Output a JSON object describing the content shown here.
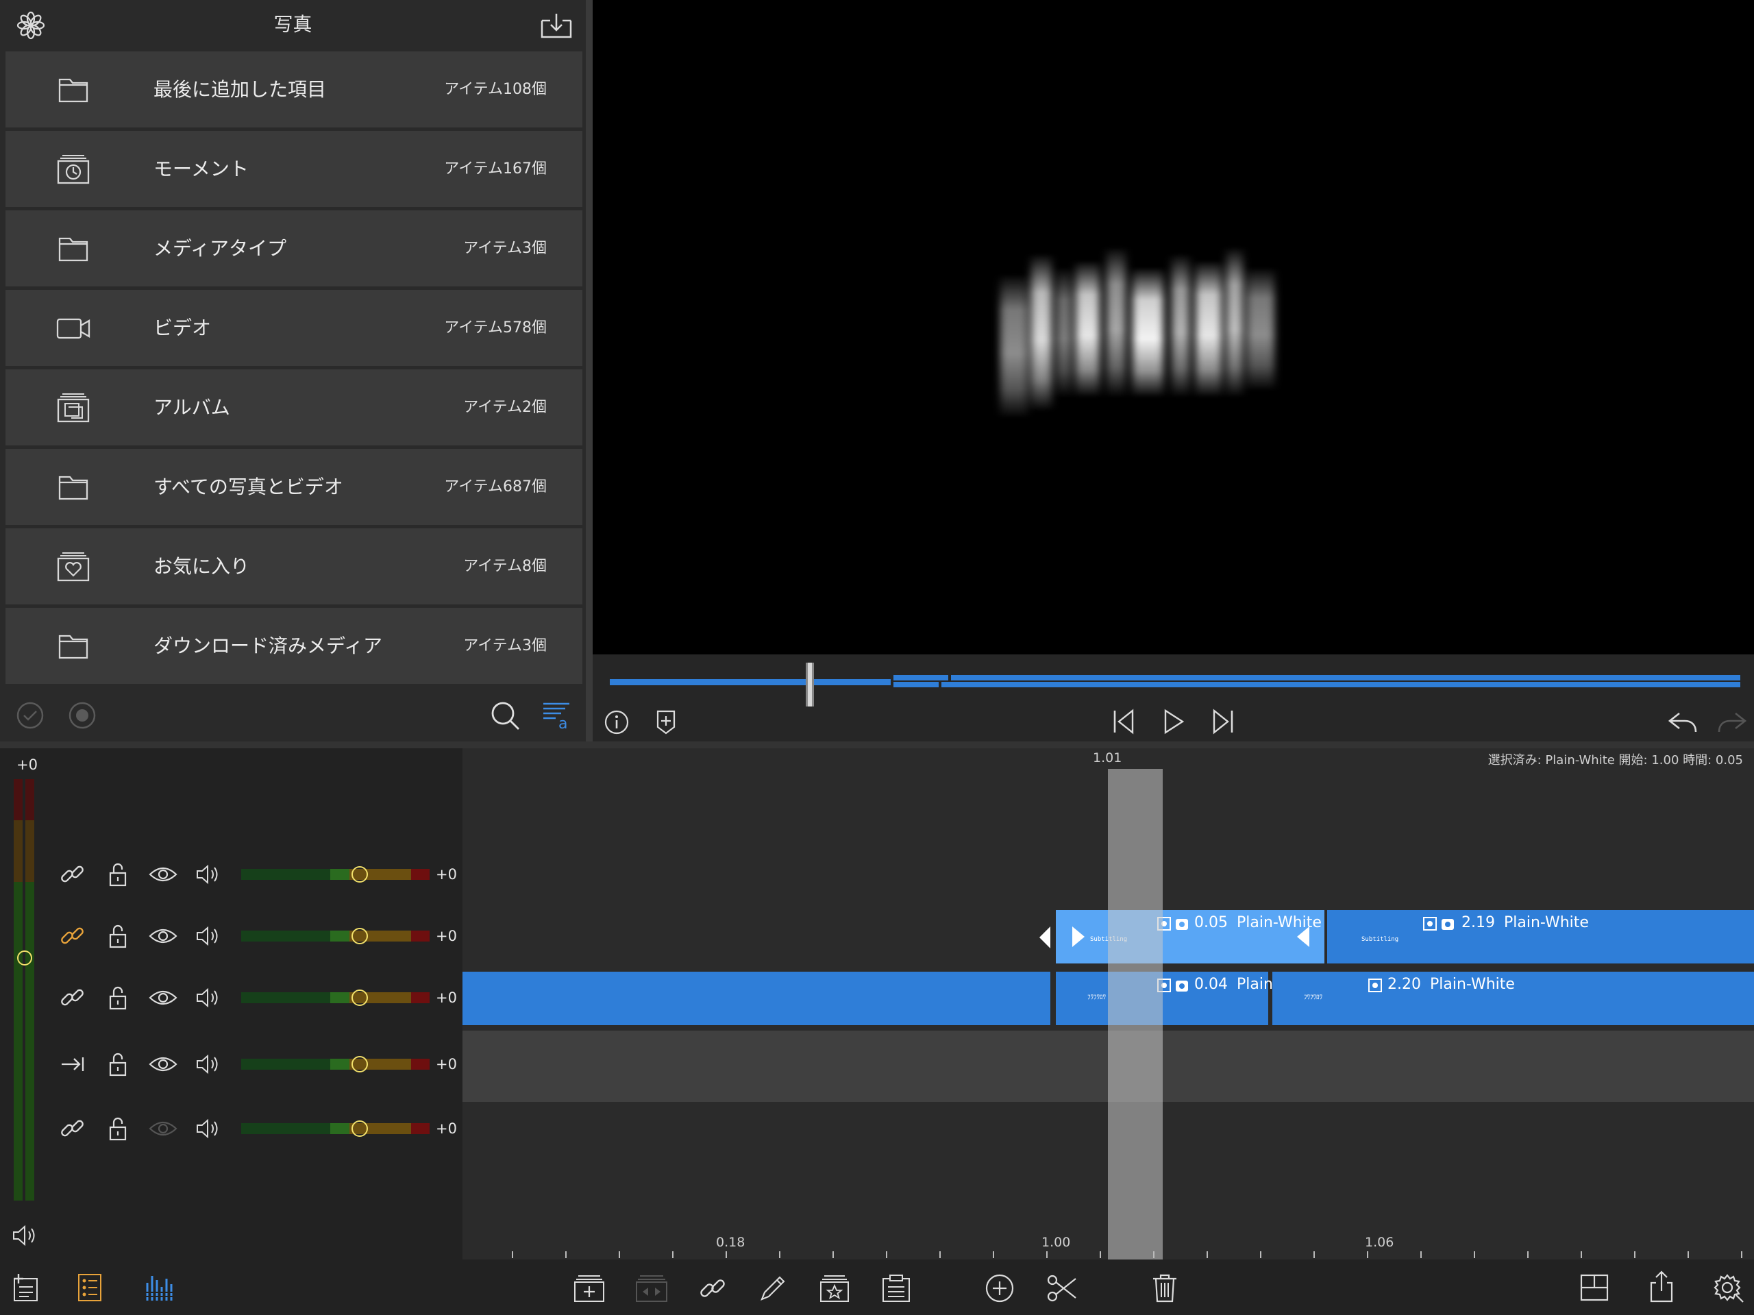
{
  "browser": {
    "title": "写真",
    "items": [
      {
        "label": "最後に追加した項目",
        "count": "アイテム108個",
        "icon": "folder-icon"
      },
      {
        "label": "モーメント",
        "count": "アイテム167個",
        "icon": "moments-clock-icon"
      },
      {
        "label": "メディアタイプ",
        "count": "アイテム3個",
        "icon": "folder-icon"
      },
      {
        "label": "ビデオ",
        "count": "アイテム578個",
        "icon": "video-camera-icon"
      },
      {
        "label": "アルバム",
        "count": "アイテム2個",
        "icon": "album-icon"
      },
      {
        "label": "すべての写真とビデオ",
        "count": "アイテム687個",
        "icon": "folder-icon"
      },
      {
        "label": "お気に入り",
        "count": "アイテム8個",
        "icon": "favorites-heart-icon"
      },
      {
        "label": "ダウンロード済みメディア",
        "count": "アイテム3個",
        "icon": "folder-icon"
      }
    ]
  },
  "timeline": {
    "master_volume": "+0",
    "track_volumes": [
      "+0",
      "+0",
      "+0",
      "+0",
      "+0"
    ],
    "selection_info": "選択済み: Plain-White 開始: 1.00 時間: 0.05",
    "playhead_time": "1.01",
    "ruler_labels": [
      "0.18",
      "1.00",
      "1.06"
    ],
    "clips": {
      "selected_title": {
        "duration": "0.05",
        "name": "Plain-White",
        "thumb": "Subtitling"
      },
      "title_2": {
        "duration": "2.19",
        "name": "Plain-White",
        "thumb": "Subtitling"
      },
      "video_1": {
        "duration": "0.04",
        "name": "Plain",
        "thumb": "ﾌﾜﾌﾜﾛﾜ"
      },
      "video_2": {
        "duration": "2.20",
        "name": "Plain-White",
        "thumb": "ﾌﾜﾌﾜﾛﾜ"
      }
    }
  },
  "colors": {
    "accent": "#2f7ed8",
    "selected_clip": "#59a6f5",
    "highlight_yellow": "#e8a33a"
  }
}
